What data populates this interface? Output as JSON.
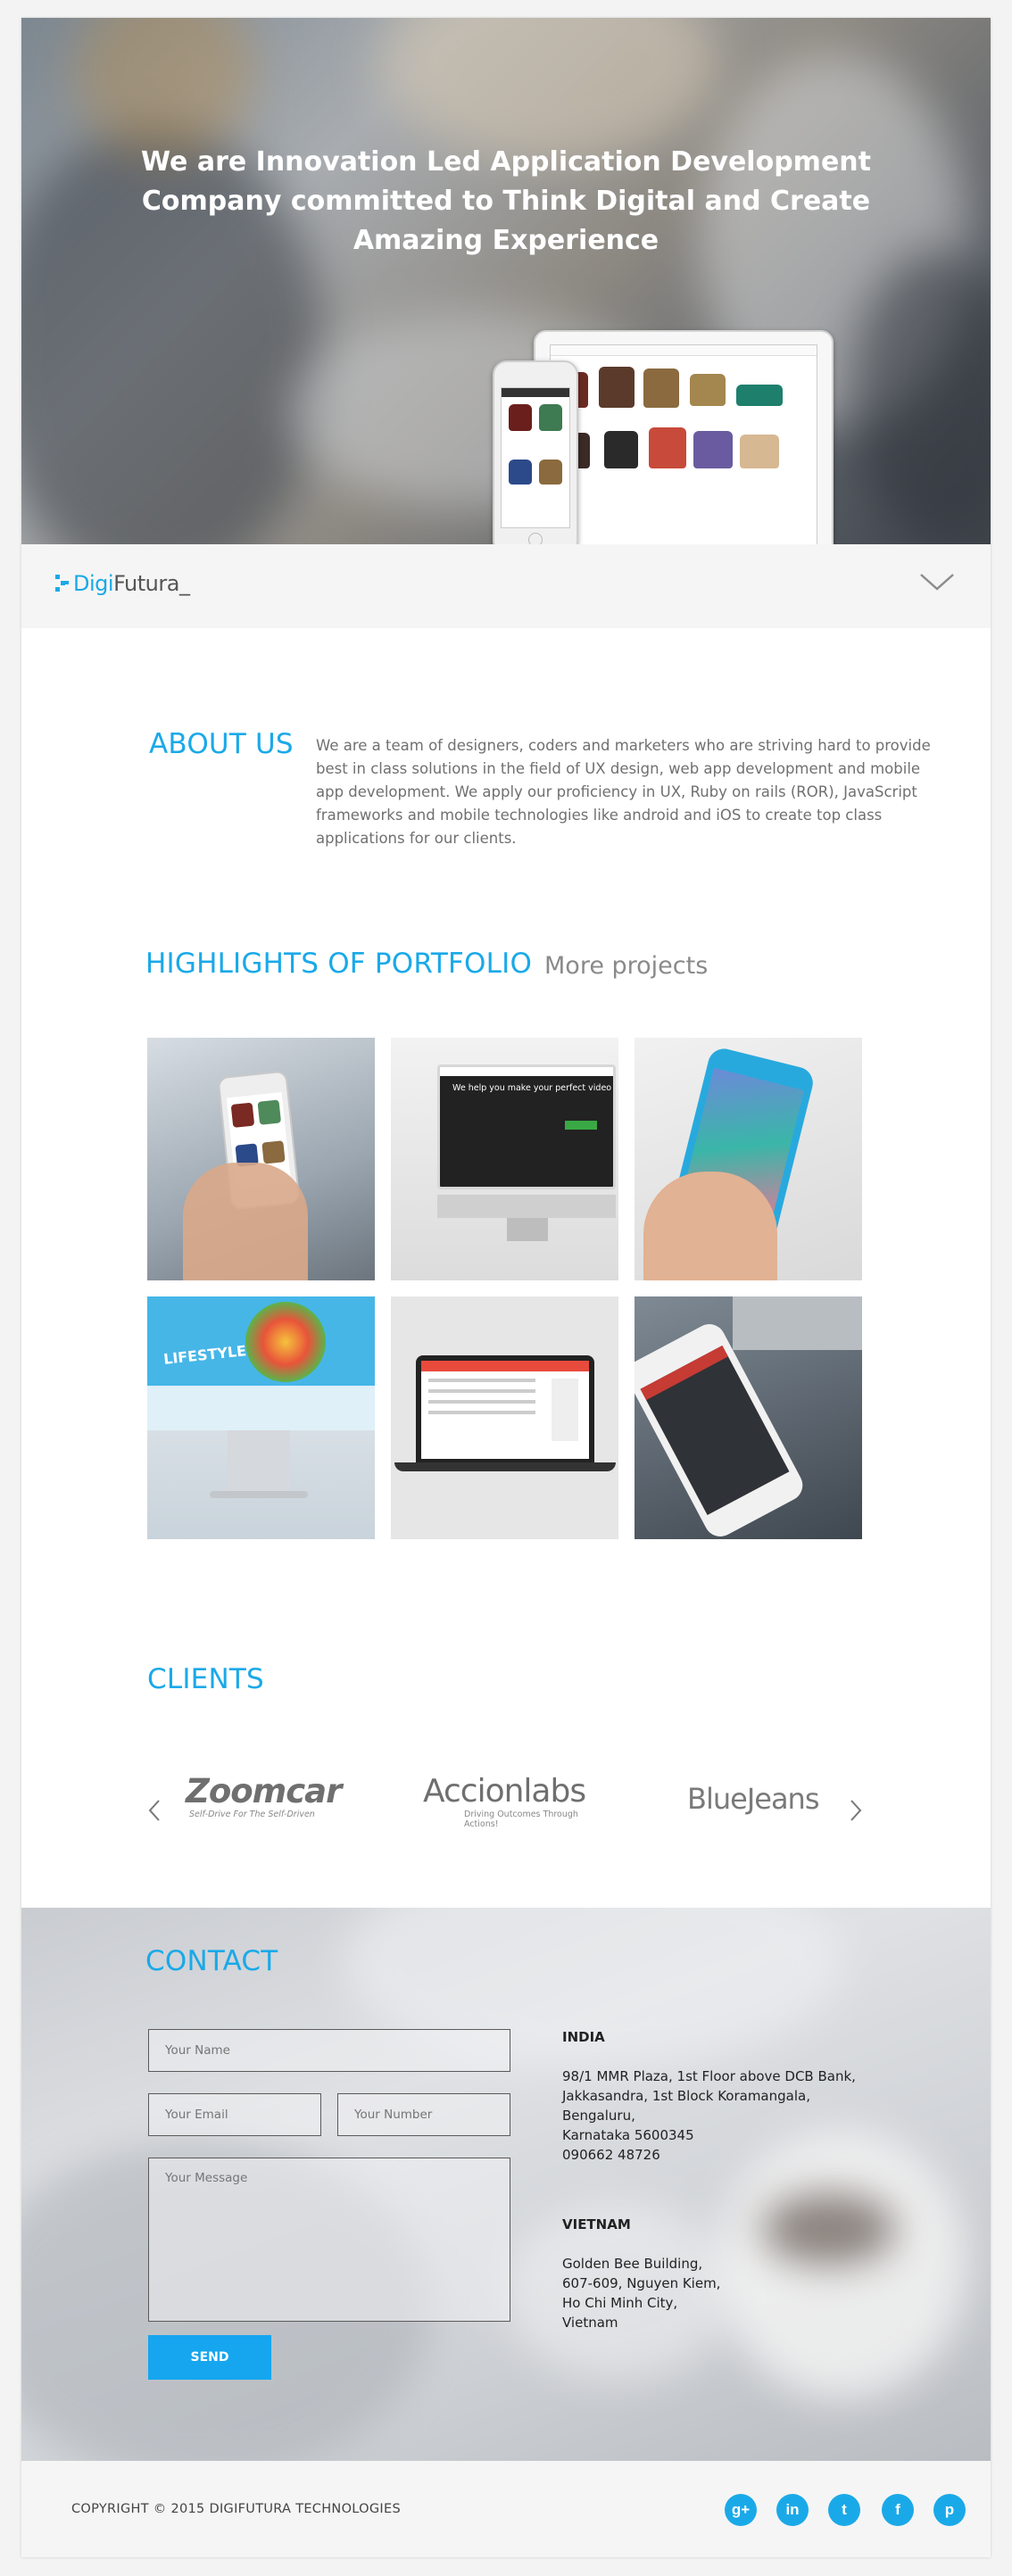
{
  "hero": {
    "headline": "We are Innovation Led Application Development Company committed to Think Digital and Create Amazing Experience"
  },
  "nav": {
    "logo_part1": "Digi",
    "logo_part2": "Futura_",
    "scroll_icon": "chevron-down-icon"
  },
  "about": {
    "title": "ABOUT US",
    "text": "We are a team of designers, coders and marketers who are striving hard to provide best in class solutions in the field of UX design, web app development and mobile app development. We apply our proficiency in UX, Ruby on rails (ROR), JavaScript frameworks and mobile technologies like android and iOS to create top class applications for our clients."
  },
  "portfolio": {
    "title": "HIGHLIGHTS OF PORTFOLIO",
    "more_link": "More projects",
    "tiles": [
      {
        "name": "portfolio-item-shopping-app"
      },
      {
        "name": "portfolio-item-video-site",
        "caption": "We help you make your perfect video"
      },
      {
        "name": "portfolio-item-iphone"
      },
      {
        "name": "portfolio-item-lifestyle-site",
        "caption": "LIFESTYLE"
      },
      {
        "name": "portfolio-item-laptop-app"
      },
      {
        "name": "portfolio-item-tracking-app"
      }
    ]
  },
  "clients": {
    "title": "CLIENTS",
    "logos": [
      {
        "name": "Zoomcar",
        "tagline": "Self-Drive For The Self-Driven"
      },
      {
        "name": "Accionlabs",
        "tagline": "Driving Outcomes Through Actions!"
      },
      {
        "name": "BlueJeans"
      }
    ]
  },
  "contact": {
    "title": "CONTACT",
    "name_placeholder": "Your Name",
    "email_placeholder": "Your Email",
    "number_placeholder": "Your Number",
    "message_placeholder": "Your Message",
    "send_label": "SEND",
    "offices": [
      {
        "country": "INDIA",
        "lines": [
          "98/1 MMR Plaza, 1st Floor above DCB Bank,",
          "Jakkasandra, 1st Block Koramangala,",
          "Bengaluru,",
          "Karnataka 5600345",
          "090662 48726"
        ]
      },
      {
        "country": "VIETNAM",
        "lines": [
          "Golden Bee Building,",
          "607-609, Nguyen Kiem,",
          "Ho Chi Minh City,",
          "Vietnam"
        ]
      }
    ]
  },
  "footer": {
    "copyright": "COPYRIGHT © 2015 DIGIFUTURA TECHNOLOGIES",
    "social": [
      {
        "icon": "google-plus-icon",
        "glyph": "g+"
      },
      {
        "icon": "linkedin-icon",
        "glyph": "in"
      },
      {
        "icon": "twitter-icon",
        "glyph": "t"
      },
      {
        "icon": "facebook-icon",
        "glyph": "f"
      },
      {
        "icon": "pinterest-icon",
        "glyph": "p"
      }
    ]
  },
  "colors": {
    "accent": "#1aa9e8",
    "button": "#15a6ef",
    "text": "#707070"
  }
}
